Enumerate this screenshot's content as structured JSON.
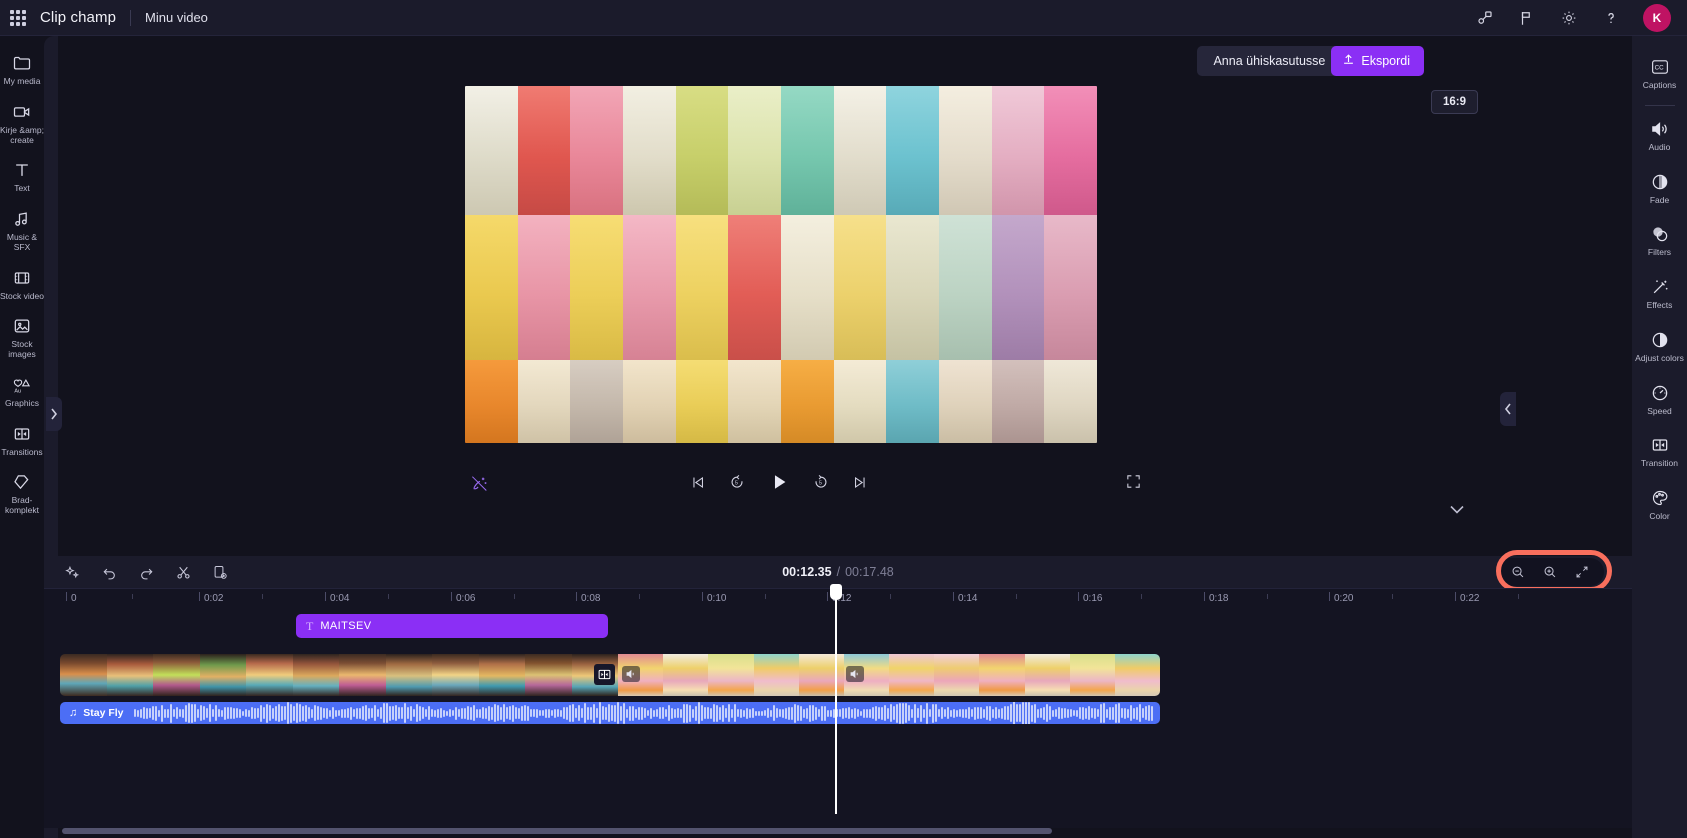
{
  "app": {
    "brand": "Clip champ",
    "project_name": "Minu video",
    "avatar_initial": "K",
    "accent_purple": "#8b2ff5",
    "accent_blue": "#4c6ef5",
    "highlight_ring": "#f96f5d",
    "bg": "#12121d"
  },
  "topbar": {
    "icons": [
      {
        "name": "integrations-icon",
        "glyph": "integrations"
      },
      {
        "name": "feedback-flag-icon",
        "glyph": "flag"
      },
      {
        "name": "settings-gear-icon",
        "glyph": "gear"
      },
      {
        "name": "help-icon",
        "glyph": "question"
      }
    ]
  },
  "left_rail": {
    "items": [
      {
        "label": "My media",
        "icon": "folder-icon"
      },
      {
        "label": "Kirje &amp; create",
        "icon": "record-create-icon"
      },
      {
        "label": "Text",
        "icon": "text-icon"
      },
      {
        "label": "Music & SFX",
        "icon": "music-icon"
      },
      {
        "label": "Stock video",
        "icon": "stock-video-icon"
      },
      {
        "label": "Stock images",
        "icon": "stock-images-icon"
      },
      {
        "label": "Graphics",
        "icon": "graphics-icon"
      },
      {
        "label": "Transitions",
        "icon": "transitions-icon"
      },
      {
        "label": "Brad-komplekt",
        "icon": "brand-kit-icon"
      }
    ]
  },
  "right_rail": {
    "items": [
      {
        "label": "Captions",
        "icon": "captions-icon"
      },
      {
        "label": "Audio",
        "icon": "audio-icon"
      },
      {
        "label": "Fade",
        "icon": "fade-icon"
      },
      {
        "label": "Filters",
        "icon": "filters-icon"
      },
      {
        "label": "Effects",
        "icon": "effects-icon"
      },
      {
        "label": "Adjust colors",
        "icon": "adjust-colors-icon"
      },
      {
        "label": "Speed",
        "icon": "speed-icon"
      },
      {
        "label": "Transition",
        "icon": "transition-icon"
      },
      {
        "label": "Color",
        "icon": "color-icon"
      }
    ]
  },
  "stage": {
    "share_label": "Anna ühiskasutusse",
    "export_label": "Ekspordi",
    "aspect_ratio": "16:9",
    "playback": {
      "skip_back": "skip-back-icon",
      "rewind": "rewind-5s-icon",
      "play": "play-icon",
      "forward": "forward-5s-icon",
      "skip_forward": "skip-forward-icon",
      "fullscreen": "fullscreen-icon",
      "magic": "magic-remove-background-icon"
    }
  },
  "timeline": {
    "toolbar_icons": [
      {
        "name": "magic-tools-icon"
      },
      {
        "name": "undo-icon"
      },
      {
        "name": "redo-icon"
      },
      {
        "name": "split-scissors-icon"
      },
      {
        "name": "duplicate-icon"
      }
    ],
    "current_time": "00:12.35",
    "total_time": "00:17.48",
    "time_separator": "/",
    "zoom_controls": [
      {
        "name": "zoom-out-icon"
      },
      {
        "name": "zoom-in-icon"
      },
      {
        "name": "fit-timeline-icon"
      }
    ],
    "ruler_labels": [
      "0",
      "0:02",
      "0:04",
      "0:06",
      "0:08",
      "0:10",
      "0:12",
      "0:14",
      "0:16",
      "0:18",
      "0:20",
      "0:22"
    ],
    "playhead_position_label": "0:12",
    "clips": {
      "text_clip": {
        "label": "MAITSEV",
        "icon": "text-clip-icon",
        "color": "#8b2ff5"
      },
      "video_clip": {
        "label": "",
        "transition_badge": "transition-icon",
        "mute_badges": [
          "volume-icon",
          "volume-icon"
        ]
      },
      "audio_clip": {
        "label": "Stay Fly",
        "icon": "music-note-icon",
        "color": "#4c6ef5"
      }
    }
  }
}
